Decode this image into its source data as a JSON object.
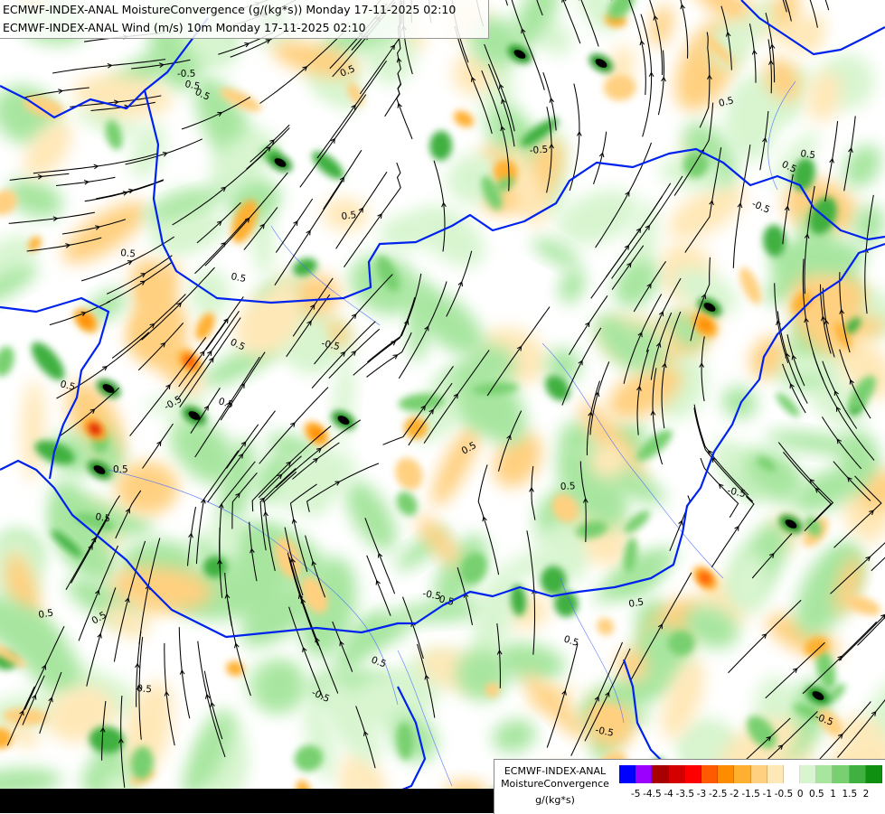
{
  "header": {
    "line1": "ECMWF-INDEX-ANAL MoistureConvergence (g/(kg*s)) Monday 17-11-2025 02:10",
    "line2": "ECMWF-INDEX-ANAL Wind (m/s) 10m Monday 17-11-2025 02:10"
  },
  "legend": {
    "title_line1": "ECMWF-INDEX-ANAL",
    "title_line2": "MoistureConvergence",
    "units": "g/(kg*s)",
    "colors": [
      "#0000ff",
      "#9b00ff",
      "#a80000",
      "#d40000",
      "#ff0000",
      "#ff5a00",
      "#ff8c00",
      "#ffb030",
      "#ffd080",
      "#ffe8b8",
      "#ffffff",
      "#d8f5d0",
      "#a8e6a0",
      "#78d070",
      "#40b040",
      "#109010"
    ],
    "labels": [
      "-5",
      "-4.5",
      "-4",
      "-3.5",
      "-3",
      "-2.5",
      "-2",
      "-1.5",
      "-1",
      "-0.5",
      "0",
      "0.5",
      "1",
      "1.5",
      "2"
    ]
  },
  "map": {
    "contour_labels": [
      "0.5",
      "-0.5",
      "0.5",
      "0.5",
      "-0.5",
      "0.5",
      "0.5",
      "-0.5",
      "0.5",
      "0.5",
      "0.5",
      "-0.5",
      "0.5",
      "0.5",
      "-0.5",
      "0.5",
      "0.5",
      "-0.5",
      "0.5",
      "0.5",
      "-0.5",
      "0.5",
      "0.5",
      "0.5",
      "-0.5",
      "0.5",
      "0.5",
      "0.5",
      "-0.5",
      "0.5",
      "0.5",
      "-0.5",
      "0.5"
    ]
  }
}
